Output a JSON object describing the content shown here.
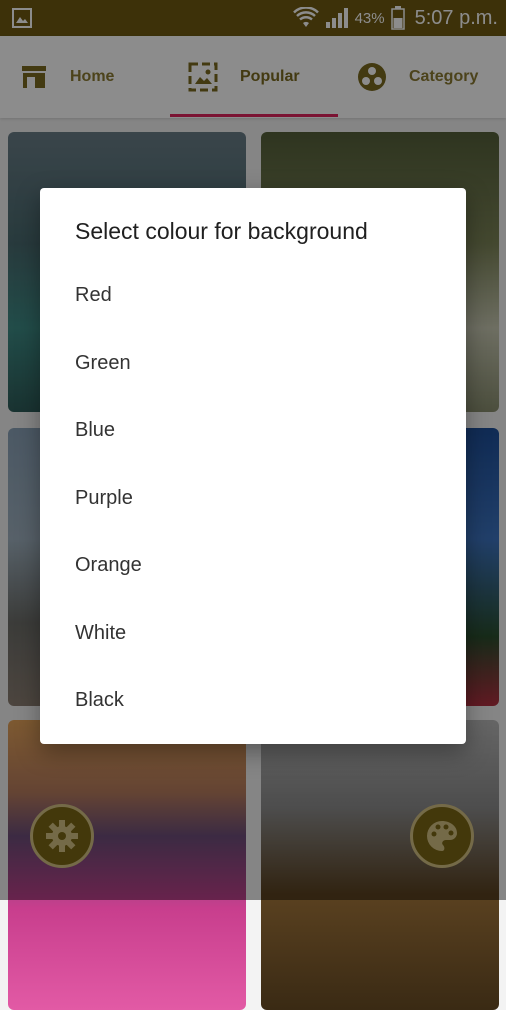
{
  "status_bar": {
    "battery_percent": "43%",
    "time": "5:07 p.m."
  },
  "nav": {
    "tabs": [
      {
        "label": "Home",
        "icon": "store-icon"
      },
      {
        "label": "Popular",
        "icon": "gallery-icon",
        "selected": true
      },
      {
        "label": "Category",
        "icon": "category-icon"
      }
    ],
    "accent": "#e0245e",
    "tab_color": "#8b7a32"
  },
  "dialog": {
    "title": "Select colour for background",
    "options": [
      "Red",
      "Green",
      "Blue",
      "Purple",
      "Orange",
      "White",
      "Black"
    ]
  },
  "fabs": {
    "left_icon": "gear-icon",
    "right_icon": "palette-icon",
    "color": "#7a6714"
  },
  "colors": {
    "status_bar": "#6f5a12",
    "scrim": "rgba(0,0,0,0.45)"
  }
}
